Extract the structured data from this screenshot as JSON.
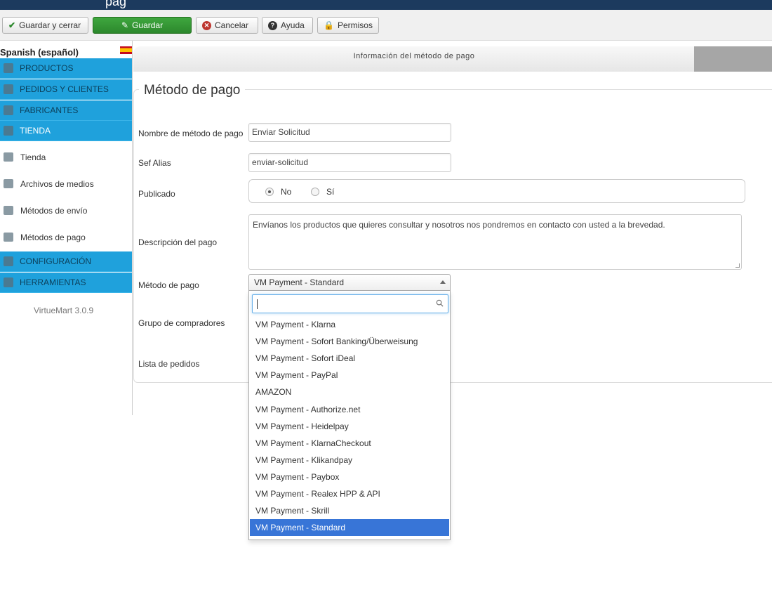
{
  "window": {
    "title": "pag"
  },
  "toolbar": {
    "save_close": "Guardar y cerrar",
    "save": "Guardar",
    "cancel": "Cancelar",
    "help": "Ayuda",
    "permissions": "Permisos"
  },
  "sidebar": {
    "language": "Spanish (español)",
    "sections": [
      {
        "label": "PRODUCTOS"
      },
      {
        "label": "PEDIDOS Y CLIENTES"
      },
      {
        "label": "FABRICANTES"
      },
      {
        "label": "TIENDA"
      },
      {
        "label": "CONFIGURACIÓN"
      },
      {
        "label": "HERRAMIENTAS"
      }
    ],
    "items": [
      {
        "label": "Tienda"
      },
      {
        "label": "Archivos de medios"
      },
      {
        "label": "Métodos de envío"
      },
      {
        "label": "Métodos de pago"
      }
    ],
    "version": "VirtueMart 3.0.9"
  },
  "tab": {
    "label": "Información del método de pago"
  },
  "form": {
    "legend": "Método de pago",
    "name_label": "Nombre de método de pago",
    "name_value": "Enviar Solicitud",
    "alias_label": "Sef Alias",
    "alias_value": "enviar-solicitud",
    "published_label": "Publicado",
    "published_no": "No",
    "published_yes": "Sí",
    "description_label": "Descripción del pago",
    "description_value": "Envíanos los productos que quieres consultar y nosotros nos pondremos en contacto con usted a la brevedad.",
    "method_label": "Método de pago",
    "method_value": "VM Payment - Standard",
    "group_label": "Grupo de compradores",
    "orders_label": "Lista de pedidos"
  },
  "dropdown": {
    "options": [
      "VM Payment - Klarna",
      "VM Payment - Sofort Banking/Überweisung",
      "VM Payment - Sofort iDeal",
      "VM Payment - PayPal",
      "AMAZON",
      "VM Payment - Authorize.net",
      "VM Payment - Heidelpay",
      "VM Payment - KlarnaCheckout",
      "VM Payment - Klikandpay",
      "VM Payment - Paybox",
      "VM Payment - Realex HPP & API",
      "VM Payment - Skrill",
      "VM Payment - Standard"
    ]
  }
}
